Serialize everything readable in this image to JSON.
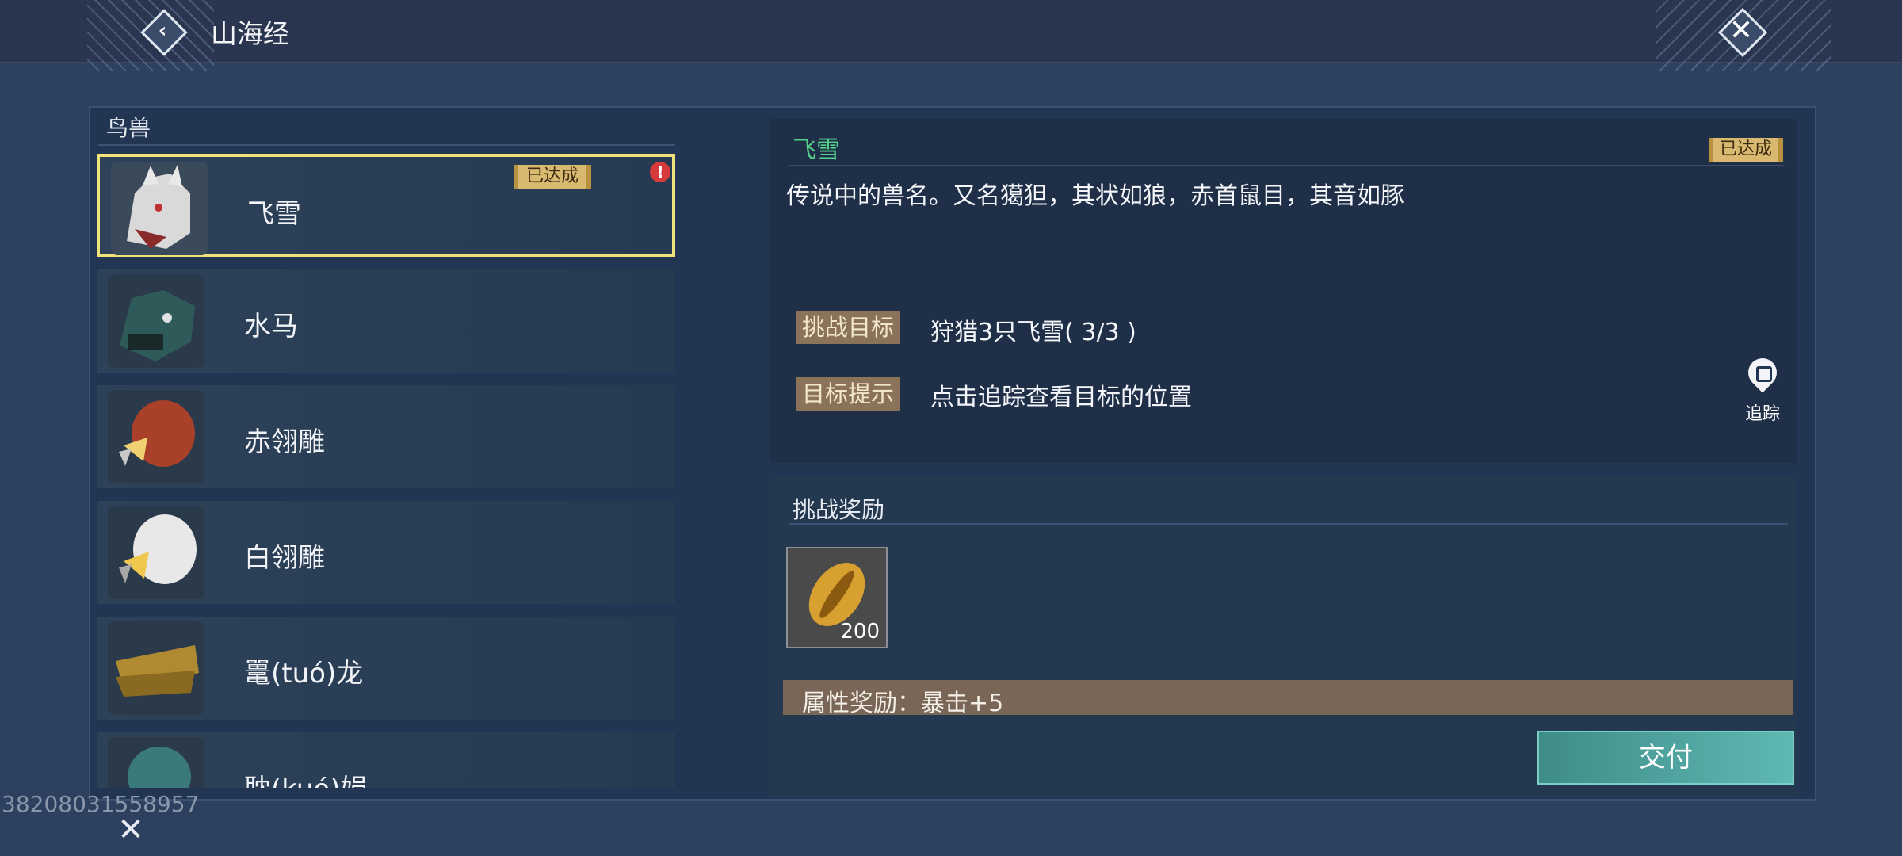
{
  "header": {
    "title": "山海经"
  },
  "category": "鸟兽",
  "beasts": [
    {
      "name": "飞雪",
      "badge": "已达成",
      "alert": "!",
      "selected": true,
      "color": "#d9d9d9"
    },
    {
      "name": "水马",
      "color": "#2f5a5a"
    },
    {
      "name": "赤翎雕",
      "color": "#a8402a"
    },
    {
      "name": "白翎雕",
      "color": "#e8e8e8"
    },
    {
      "name": "鼍(tuó)龙",
      "color": "#b08a30"
    },
    {
      "name": "耽(kuó)娟",
      "color": "#3a7a7a"
    }
  ],
  "detail": {
    "name": "飞雪",
    "badge": "已达成",
    "description": "传说中的兽名。又名獦狚，其状如狼，赤首鼠目，其音如豚",
    "challenge_label": "挑战目标",
    "challenge_value": "狩猎3只飞雪( 3/3 )",
    "hint_label": "目标提示",
    "hint_value": "点击追踪查看目标的位置",
    "track_label": "追踪"
  },
  "reward": {
    "title": "挑战奖励",
    "item_quantity": "200",
    "attribute": "属性奖励：暴击+5",
    "submit_label": "交付"
  },
  "footer": {
    "uid": "38208031558957"
  },
  "icons": {
    "back": "back-icon",
    "close": "close-icon",
    "track": "map-pin-icon",
    "shell": "shell-icon"
  }
}
